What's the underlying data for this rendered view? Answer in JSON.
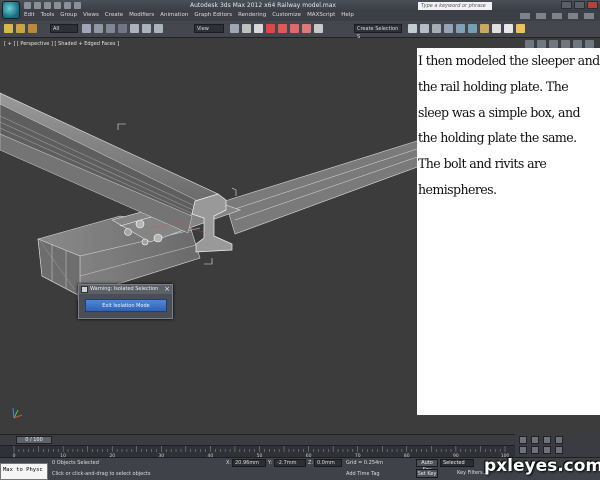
{
  "window": {
    "title": "Autodesk 3ds Max  2012 x64      Railway model.max",
    "help_search_placeholder": "Type a keyword or phrase"
  },
  "menu": {
    "items": [
      "Edit",
      "Tools",
      "Group",
      "Views",
      "Create",
      "Modifiers",
      "Animation",
      "Graph Editors",
      "Rendering",
      "Customize",
      "MAXScript",
      "Help"
    ]
  },
  "toolbar": {
    "filter_value": "All",
    "ref_coord_value": "View",
    "selection_set_value": "Create Selection S"
  },
  "viewport": {
    "label": "[ + ] [ Perspective ] [ Shaded + Edged Faces ]"
  },
  "dialog": {
    "title": "Warning: Isolated Selection",
    "close_label": "×",
    "button_label": "Exit Isolation Mode"
  },
  "note": {
    "text": "I then modeled the sleeper and the rail holding plate. The sleep was a simple box, and the holding plate the same. The bolt and rivits are hemispheres."
  },
  "timeline": {
    "slider_label": "0 / 100",
    "ticks": [
      "0",
      "10",
      "20",
      "30",
      "40",
      "50",
      "60",
      "70",
      "80",
      "90",
      "100"
    ]
  },
  "status": {
    "maxscript": "Max to Physc",
    "objects_selected": "0 Objects Selected",
    "prompt": "Click or click-and-drag to select objects",
    "x_label": "X:",
    "x_value": "20.96mm",
    "y_label": "Y:",
    "y_value": "-2.7mm",
    "z_label": "Z:",
    "z_value": "0.0mm",
    "grid": "Grid = 0.254m",
    "add_time_tag": "Add Time Tag",
    "auto_key": "Auto Key",
    "set_key": "Set Key",
    "selected": "Selected",
    "key_filters": "Key Filters..."
  },
  "watermark": "pxleyes.com"
}
